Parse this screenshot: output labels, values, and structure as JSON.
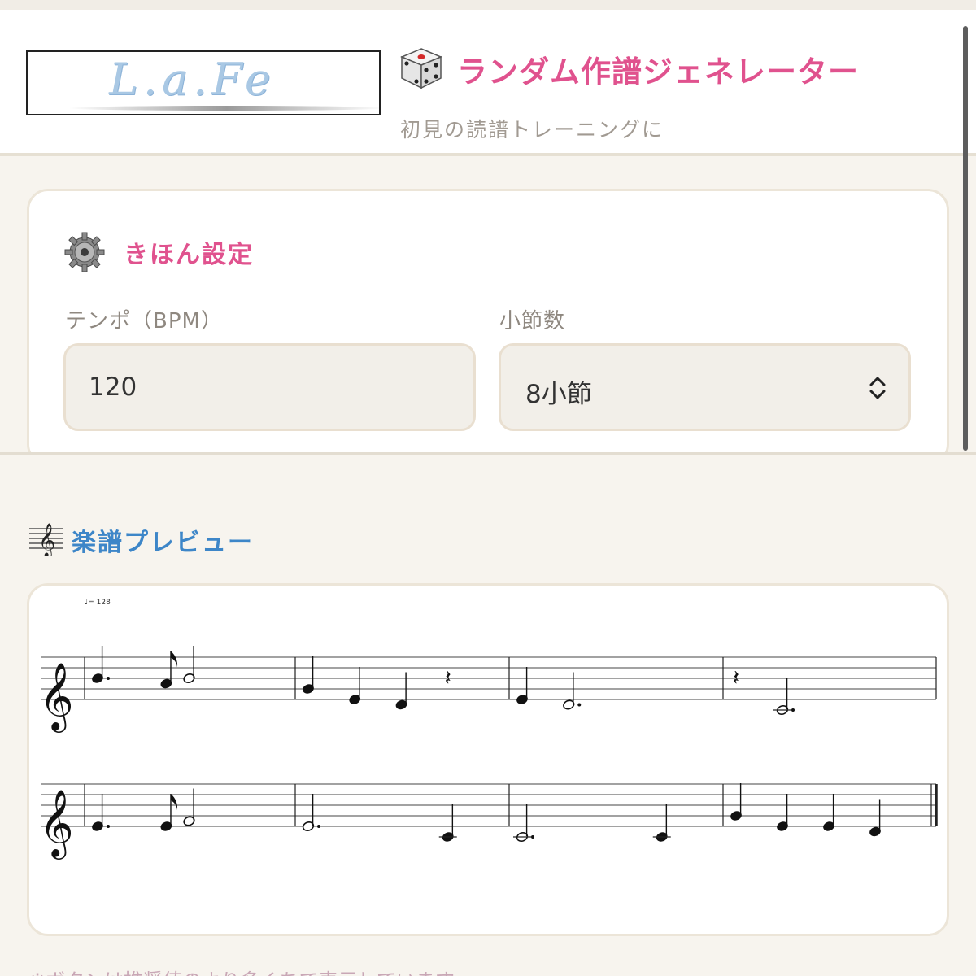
{
  "header": {
    "logo_text": "L.a.Fe",
    "title": "ランダム作譜ジェネレーター",
    "subtitle": "初見の読譜トレーニングに"
  },
  "settings": {
    "section_title": "きほん設定",
    "tempo_label": "テンポ（BPM）",
    "tempo_value": "120",
    "measures_label": "小節数",
    "measures_value": "8小節"
  },
  "preview": {
    "section_title": "楽譜プレビュー",
    "tempo_marking": "♩= 128",
    "systems": [
      {
        "measures": [
          [
            {
              "pitch": "B4",
              "dur": "q."
            },
            {
              "pitch": "A4",
              "dur": "8"
            },
            {
              "pitch": "B4",
              "dur": "h"
            }
          ],
          [
            {
              "pitch": "G4",
              "dur": "q"
            },
            {
              "pitch": "E4",
              "dur": "q"
            },
            {
              "pitch": "D4",
              "dur": "q"
            },
            {
              "pitch": "rest",
              "dur": "q"
            }
          ],
          [
            {
              "pitch": "E4",
              "dur": "q"
            },
            {
              "pitch": "D4",
              "dur": "h."
            }
          ],
          [
            {
              "pitch": "rest",
              "dur": "q"
            },
            {
              "pitch": "C4",
              "dur": "h."
            }
          ]
        ]
      },
      {
        "measures": [
          [
            {
              "pitch": "E4",
              "dur": "q."
            },
            {
              "pitch": "E4",
              "dur": "8"
            },
            {
              "pitch": "F4",
              "dur": "h"
            }
          ],
          [
            {
              "pitch": "E4",
              "dur": "h."
            },
            {
              "pitch": "C4",
              "dur": "q"
            }
          ],
          [
            {
              "pitch": "C4",
              "dur": "h."
            },
            {
              "pitch": "C4",
              "dur": "q"
            }
          ],
          [
            {
              "pitch": "G4",
              "dur": "q"
            },
            {
              "pitch": "E4",
              "dur": "q"
            },
            {
              "pitch": "E4",
              "dur": "q"
            },
            {
              "pitch": "D4",
              "dur": "q"
            }
          ]
        ]
      }
    ]
  },
  "footer": {
    "note": "※ボタンは推奨値のより多くちて表示しています"
  },
  "colors": {
    "accent_pink": "#e0528e",
    "accent_blue": "#3d86c8",
    "field_bg": "#f2efe9"
  }
}
